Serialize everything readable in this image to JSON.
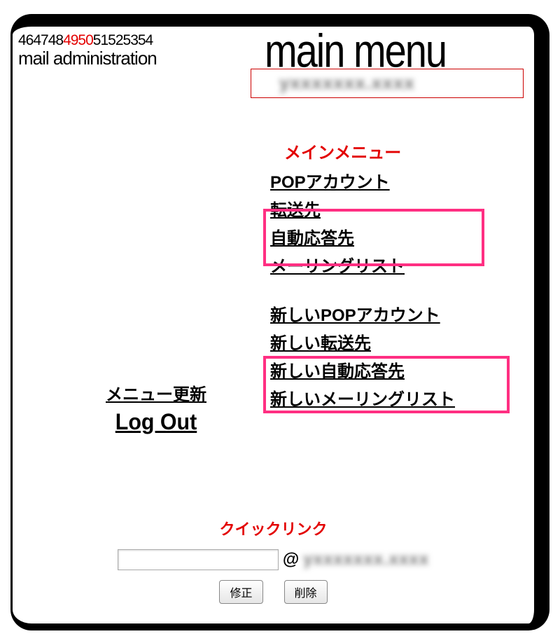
{
  "header": {
    "numbers_before": "464748",
    "numbers_hot": "4950",
    "numbers_after": "51525354",
    "mail_admin": "mail administration",
    "main_menu": "main menu",
    "domain_masked": "yxxxxxxx.xxxx"
  },
  "menu": {
    "heading": "メインメニュー",
    "items_a": [
      "POPアカウント",
      "転送先",
      "自動応答先",
      "メーリングリスト"
    ],
    "items_b": [
      "新しいPOPアカウント",
      "新しい転送先",
      "新しい自動応答先",
      "新しいメーリングリスト"
    ]
  },
  "sidebar": {
    "refresh": "メニュー更新",
    "logout": "Log Out"
  },
  "quick": {
    "heading": "クイックリンク",
    "at": "@",
    "domain_masked": "yxxxxxxx.xxxx",
    "edit_btn": "修正",
    "delete_btn": "削除"
  }
}
